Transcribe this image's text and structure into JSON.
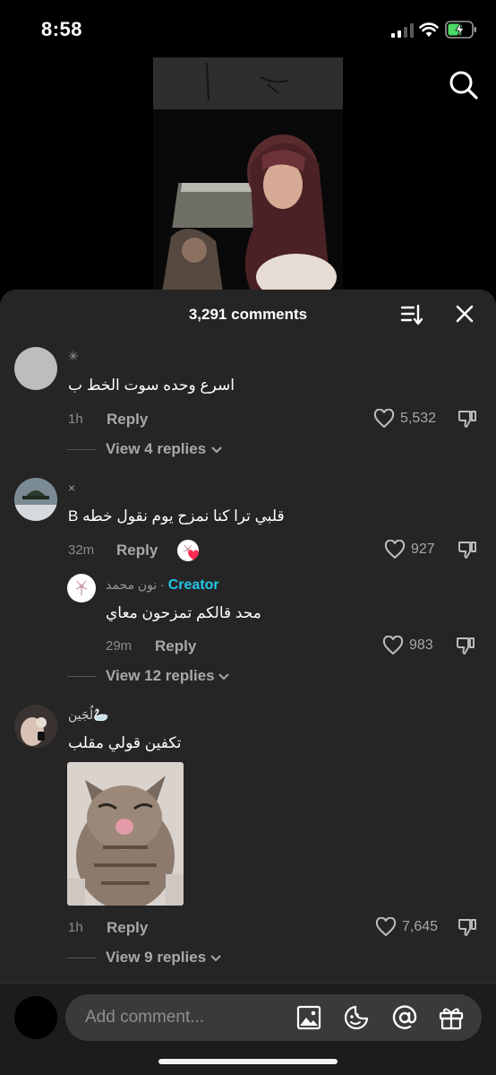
{
  "status_bar": {
    "time": "8:58"
  },
  "panel": {
    "title": "3,291 comments"
  },
  "comments": [
    {
      "username": "✳",
      "text": "اسرع وحده سوت الخط ب",
      "time": "1h",
      "reply_label": "Reply",
      "likes": "5,532",
      "view_replies": "View 4 replies"
    },
    {
      "username": "×",
      "text": "قلبي ترا كنا نمزح يوم نقول خطه B",
      "time": "32m",
      "reply_label": "Reply",
      "likes": "927",
      "creator_reply": {
        "username": "نون محمد",
        "separator": " · ",
        "creator_label": "Creator",
        "text": "محد قالكم تمزحون معاي",
        "time": "29m",
        "reply_label": "Reply",
        "likes": "983"
      },
      "view_replies": "View 12 replies"
    },
    {
      "username": "لُجَين🦢",
      "text": "تكفين قولي مقلب",
      "time": "1h",
      "reply_label": "Reply",
      "likes": "7,645",
      "view_replies": "View 9 replies"
    }
  ],
  "input": {
    "placeholder": "Add comment..."
  },
  "icons": {
    "status": [
      "signal-icon",
      "wifi-icon",
      "battery-charging-icon"
    ],
    "top": [
      "search-icon",
      "sort-icon",
      "close-icon"
    ],
    "comment_actions": [
      "heart-icon",
      "dislike-icon",
      "chevron-down-icon"
    ],
    "input_tools": [
      "image-icon",
      "sticker-icon",
      "mention-icon",
      "gift-icon"
    ]
  },
  "colors": {
    "panel": "#252525",
    "creator": "#20c7e8",
    "battery": "#4cd964",
    "liked_heart": "#fe2c55"
  }
}
